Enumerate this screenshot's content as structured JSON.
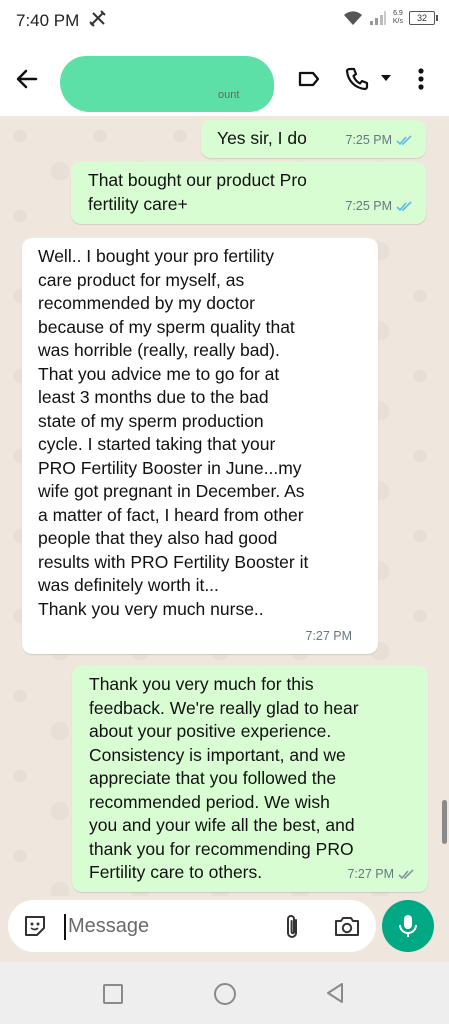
{
  "status_bar": {
    "time": "7:40 PM",
    "speed": "6.9\nK/s",
    "battery": "32"
  },
  "header": {
    "contact_sub": "ount"
  },
  "messages": [
    {
      "dir": "out",
      "text": "Yes sir, I do",
      "time": "7:25 PM",
      "ticks": "read"
    },
    {
      "dir": "out",
      "text": "That bought our product Pro\nfertility care+",
      "time": "7:25 PM",
      "ticks": "read"
    },
    {
      "dir": "in",
      "text": "Well.. I bought your pro fertility\ncare product for myself, as\nrecommended by my doctor\nbecause of my sperm quality that\nwas horrible (really, really bad).\nThat you advice me to go for at\nleast 3 months due to the bad\nstate of my sperm production\ncycle. I started taking that your\nPRO Fertility Booster in June...my\nwife got pregnant in December. As\na matter of fact, I heard from other\npeople that they also had good\nresults with PRO Fertility Booster it\nwas definitely worth it...\nThank you very much nurse..",
      "time": "7:27 PM"
    },
    {
      "dir": "out",
      "text": "Thank you very much for this\nfeedback. We're really glad to hear\nabout your positive experience.\nConsistency is important, and we\nappreciate that you followed the\nrecommended period. We wish\nyou and your wife all the best, and\nthank you for recommending PRO\nFertility care to others.",
      "time": "7:27 PM",
      "ticks": "delivered"
    }
  ],
  "composer": {
    "placeholder": "Message"
  },
  "colors": {
    "outgoing": "#d9fdd3",
    "incoming": "#ffffff",
    "accent": "#00a884",
    "read_tick": "#53bdeb",
    "delivered_tick": "#8696a0"
  },
  "icons": [
    "back-arrow-icon",
    "label-icon",
    "phone-icon",
    "dropdown-caret-icon",
    "more-vert-icon",
    "sticker-icon",
    "attach-icon",
    "camera-icon",
    "mic-icon"
  ]
}
